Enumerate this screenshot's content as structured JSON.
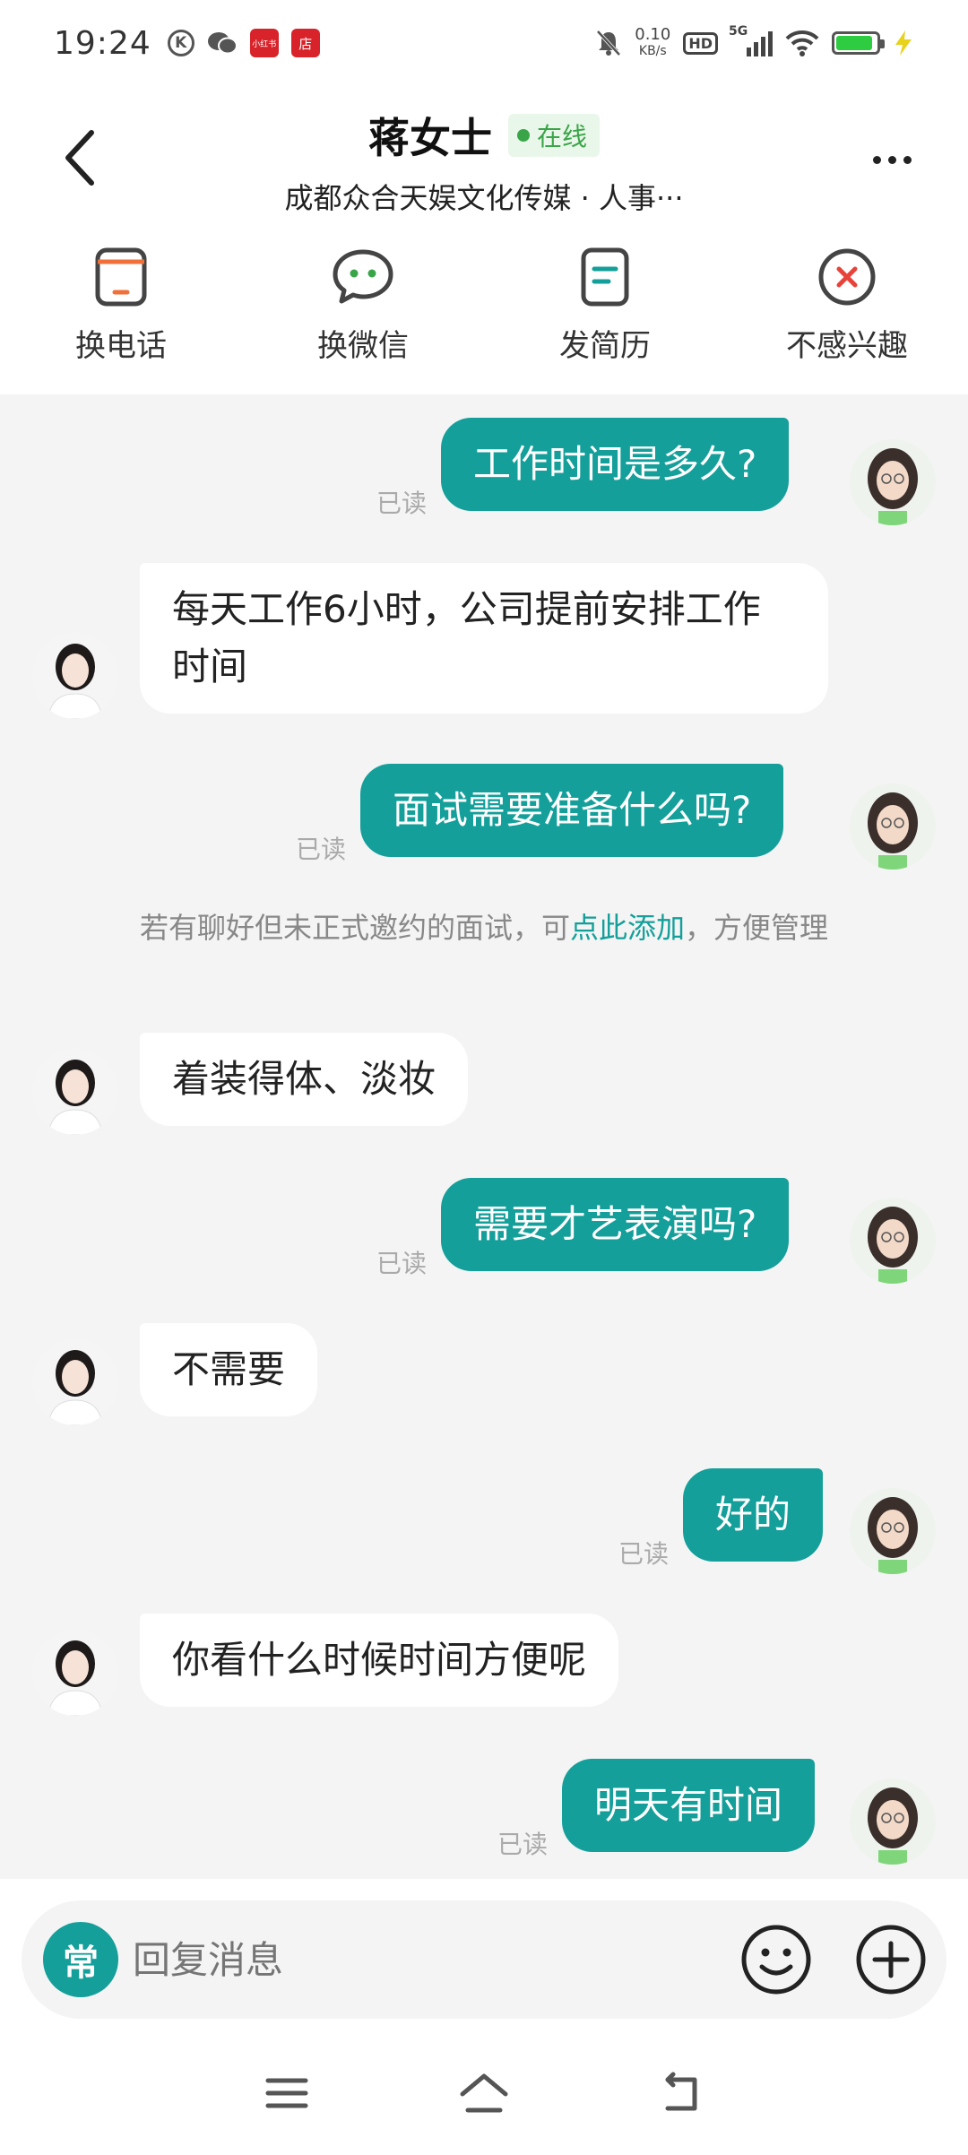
{
  "status_bar": {
    "time": "19:24",
    "speed_value": "0.10",
    "speed_unit": "KB/s",
    "hd_label": "HD",
    "net_label": "5G",
    "app_badge_1": "小红书",
    "app_badge_2": "店"
  },
  "header": {
    "name": "蒋女士",
    "online_label": "在线",
    "subtitle": "成都众合天娱文化传媒 · 人事···"
  },
  "actions": [
    {
      "label": "换电话",
      "icon": "phone-swap-icon"
    },
    {
      "label": "换微信",
      "icon": "wechat-swap-icon"
    },
    {
      "label": "发简历",
      "icon": "resume-icon"
    },
    {
      "label": "不感兴趣",
      "icon": "not-interested-icon"
    }
  ],
  "messages": {
    "m1": {
      "text": "工作时间是多久?",
      "read": "已读"
    },
    "m2": {
      "text": "每天工作6小时，公司提前安排工作时间"
    },
    "m3": {
      "text": "面试需要准备什么吗?",
      "read": "已读"
    },
    "system_note": {
      "pre": "若有聊好但未正式邀约的面试，可",
      "link": "点此添加",
      "post": "，方便管理"
    },
    "m4": {
      "text": "着装得体、淡妆"
    },
    "m5": {
      "text": "需要才艺表演吗?",
      "read": "已读"
    },
    "m6": {
      "text": "不需要"
    },
    "m7": {
      "text": "好的",
      "read": "已读"
    },
    "m8": {
      "text": "你看什么时候时间方便呢"
    },
    "m9": {
      "text": "明天有时间",
      "read": "已读"
    }
  },
  "input_bar": {
    "quick_label": "常",
    "placeholder": "回复消息"
  },
  "colors": {
    "accent": "#149f9a",
    "online": "#3aa548",
    "background": "#f4f4f4"
  }
}
